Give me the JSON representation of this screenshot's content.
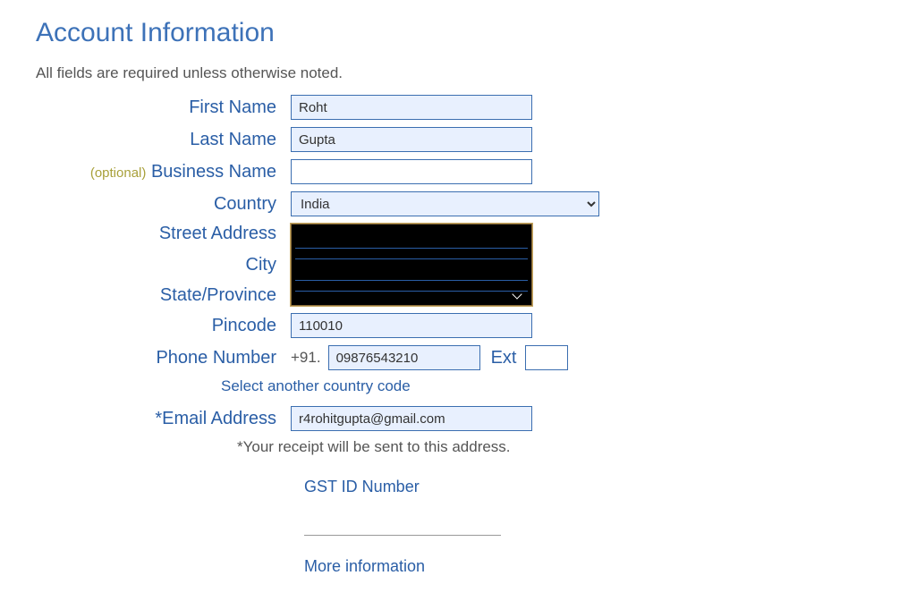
{
  "header": {
    "title": "Account Information",
    "required_note": "All fields are required unless otherwise noted."
  },
  "labels": {
    "first_name": "First Name",
    "last_name": "Last Name",
    "business_name": "Business Name",
    "optional_tag": "(optional)",
    "country": "Country",
    "street_address": "Street Address",
    "city": "City",
    "state_province": "State/Province",
    "pincode": "Pincode",
    "phone_number": "Phone Number",
    "ext": "Ext",
    "email_address": "*Email Address",
    "select_another_code": "Select another country code",
    "receipt_note": "*Your receipt will be sent to this address.",
    "gst_id": "GST ID Number",
    "more_info": "More information"
  },
  "values": {
    "first_name": "Roht",
    "last_name": "Gupta",
    "business_name": "",
    "country": "India",
    "pincode": "110010",
    "phone_prefix": "+91.",
    "phone": "09876543210",
    "ext": "",
    "email": "r4rohitgupta@gmail.com",
    "gst_id": ""
  }
}
